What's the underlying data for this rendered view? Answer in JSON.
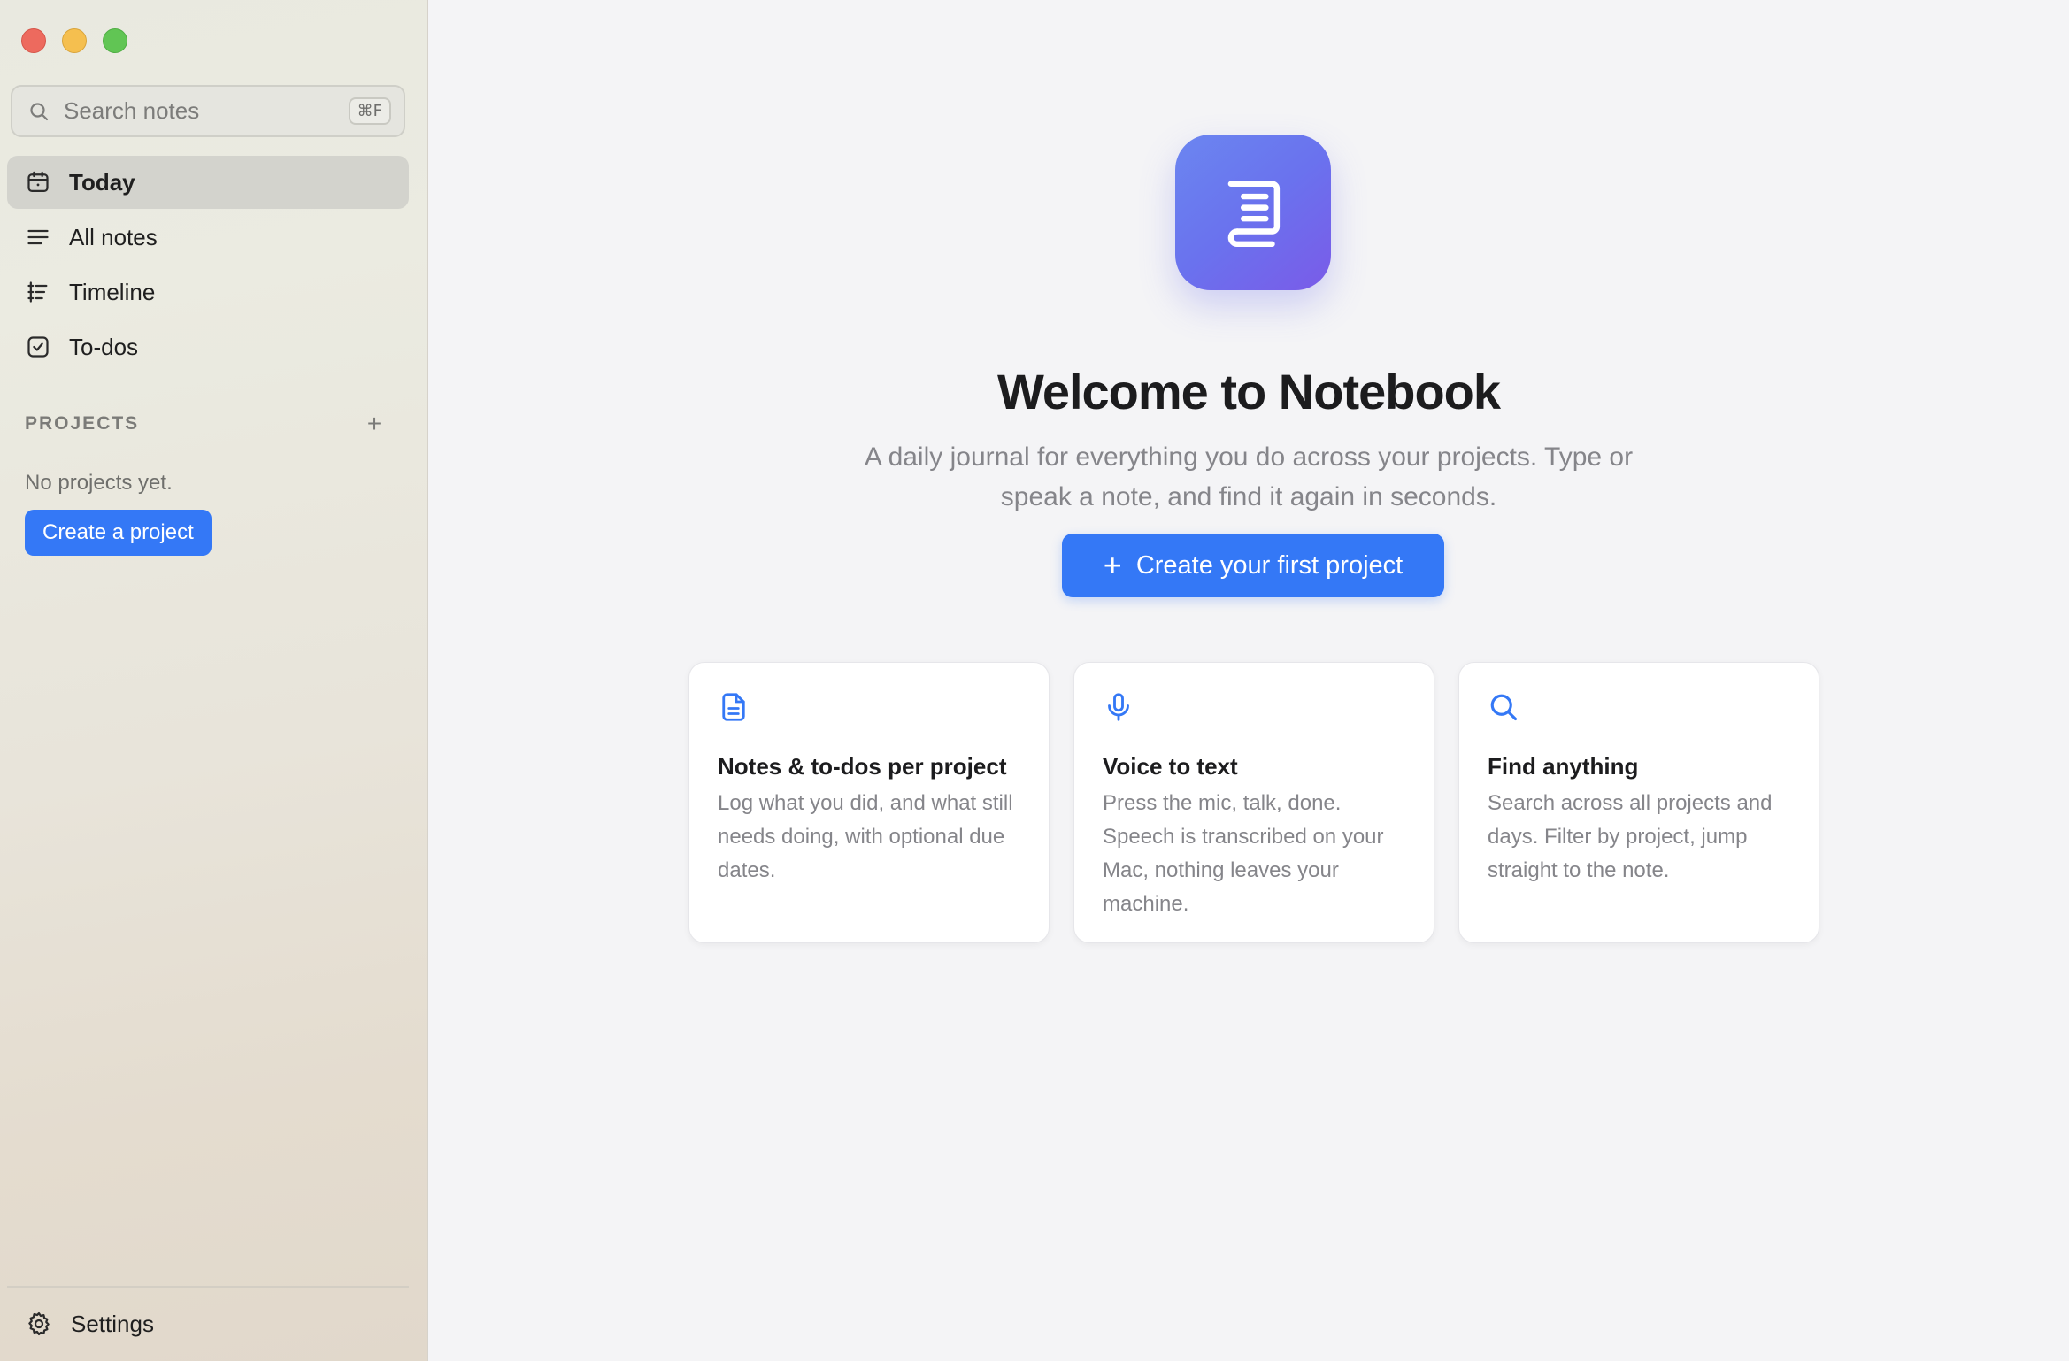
{
  "window": {
    "controls": [
      "close",
      "minimize",
      "maximize"
    ]
  },
  "sidebar": {
    "search": {
      "placeholder": "Search notes",
      "shortcut": "⌘F",
      "icon": "search-icon"
    },
    "nav": [
      {
        "label": "Today",
        "icon": "calendar-icon",
        "active": true
      },
      {
        "label": "All notes",
        "icon": "lines-icon",
        "active": false
      },
      {
        "label": "Timeline",
        "icon": "timeline-icon",
        "active": false
      },
      {
        "label": "To-dos",
        "icon": "checkbox-icon",
        "active": false
      }
    ],
    "projects": {
      "title": "PROJECTS",
      "add_label": "+",
      "empty_text": "No projects yet.",
      "create_label": "Create a project"
    },
    "settings_label": "Settings"
  },
  "main": {
    "title": "Welcome to Notebook",
    "subtitle": "A daily journal for everything you do across your projects. Type or speak a note, and find it again in seconds.",
    "cta": {
      "plus": "+",
      "label": "Create your first project"
    },
    "cards": [
      {
        "icon": "document-icon",
        "title": "Notes & to-dos per project",
        "description": "Log what you did, and what still needs doing, with optional due dates."
      },
      {
        "icon": "microphone-icon",
        "title": "Voice to text",
        "description": "Press the mic, talk, done. Speech is transcribed on your Mac, nothing leaves your machine."
      },
      {
        "icon": "search-icon",
        "title": "Find anything",
        "description": "Search across all projects and days. Filter by project, jump straight to the note."
      }
    ]
  },
  "colors": {
    "accent": "#3478f6",
    "logo_gradient_start": "#6b86f0",
    "logo_gradient_end": "#7a5be8"
  }
}
